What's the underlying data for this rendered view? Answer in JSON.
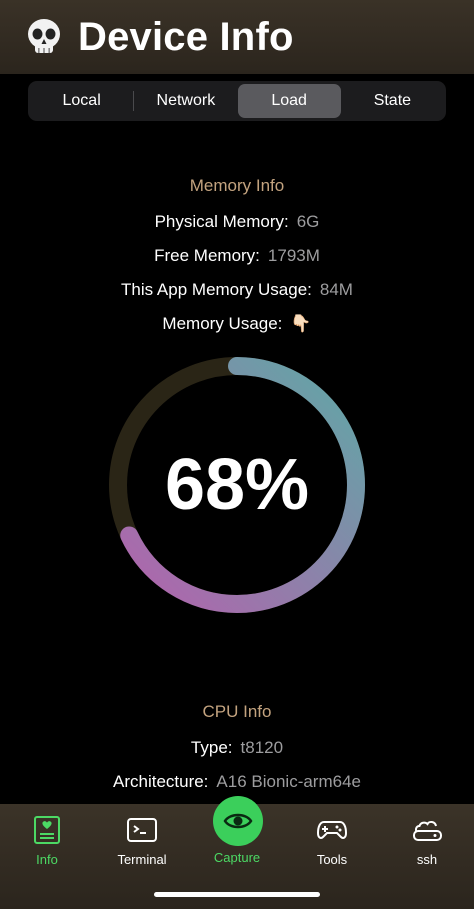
{
  "header": {
    "title": "Device Info",
    "icon": "skull-icon"
  },
  "tabs": [
    {
      "label": "Local",
      "active": false
    },
    {
      "label": "Network",
      "active": false
    },
    {
      "label": "Load",
      "active": true
    },
    {
      "label": "State",
      "active": false
    }
  ],
  "memory": {
    "title": "Memory Info",
    "rows": [
      {
        "label": "Physical Memory:",
        "value": "6G"
      },
      {
        "label": "Free Memory:",
        "value": "1793M"
      },
      {
        "label": "This App Memory Usage:",
        "value": "84M"
      },
      {
        "label": "Memory Usage:",
        "value": "👇🏻"
      }
    ],
    "usage_text": "68%",
    "usage_fraction": 0.68
  },
  "cpu": {
    "title": "CPU Info",
    "rows": [
      {
        "label": "Type:",
        "value": "t8120"
      },
      {
        "label": "Architecture:",
        "value": "A16 Bionic-arm64e"
      }
    ]
  },
  "tabbar": {
    "items": [
      {
        "label": "Info",
        "icon": "heart-card-icon",
        "active": true
      },
      {
        "label": "Terminal",
        "icon": "terminal-icon",
        "active": false
      },
      {
        "label": "Capture",
        "icon": "eye-icon",
        "active": true
      },
      {
        "label": "Tools",
        "icon": "gamepad-icon",
        "active": false
      },
      {
        "label": "ssh",
        "icon": "cloud-drive-icon",
        "active": false
      }
    ]
  },
  "colors": {
    "accent": "#4cd964",
    "section_title": "#c3a37f",
    "gauge_start": "#b461ad",
    "gauge_end": "#5fa8a6",
    "track": "#2a2516"
  }
}
